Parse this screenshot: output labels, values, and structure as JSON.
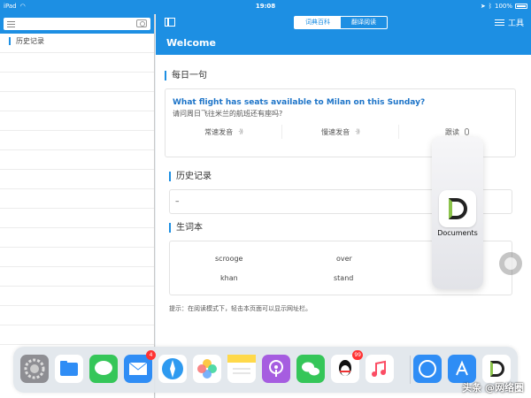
{
  "status_bar": {
    "device": "iPad",
    "time": "19:08",
    "battery": "100%"
  },
  "left_panel": {
    "title": "历史记录"
  },
  "toolbar": {
    "tabs": [
      "词典百科",
      "翻译阅读"
    ],
    "active_tab": 0,
    "tools_label": "工具"
  },
  "welcome": "Welcome",
  "daily_sentence": {
    "title": "每日一句",
    "english": "What flight has seats available to Milan on this Sunday?",
    "chinese": "请问周日飞往米兰的航班还有座吗?",
    "actions": [
      "常速发音",
      "慢速发音",
      "跟读"
    ]
  },
  "history": {
    "title": "历史记录",
    "placeholder": "–"
  },
  "vocabulary": {
    "title": "生词本",
    "words": [
      "scrooge",
      "over",
      "khan",
      "stand"
    ]
  },
  "tip": "提示：在阅读模式下，轻击本页面可以显示网址栏。",
  "slide_over": {
    "app_name": "Documents"
  },
  "dock": {
    "apps": [
      {
        "name": "settings-icon",
        "color": "#8e8e93"
      },
      {
        "name": "files-icon",
        "color": "#2f8df5"
      },
      {
        "name": "messages-icon",
        "color": "#35c659"
      },
      {
        "name": "mail-icon",
        "color": "#2f8df5",
        "badge": "4"
      },
      {
        "name": "safari-icon",
        "color": "#2e9af0"
      },
      {
        "name": "photos-icon",
        "color": "#ffffff"
      },
      {
        "name": "notes-icon",
        "color": "#ffd94a"
      },
      {
        "name": "podcasts-icon",
        "color": "#a65de0"
      },
      {
        "name": "wechat-icon",
        "color": "#35c659"
      },
      {
        "name": "qq-icon",
        "color": "#ffffff",
        "badge": "99"
      },
      {
        "name": "music-icon",
        "color": "#fb4d64"
      },
      {
        "name": "translate-app-icon",
        "color": "#2f8df5"
      },
      {
        "name": "app-store-icon",
        "color": "#2f8df5"
      },
      {
        "name": "documents-icon",
        "color": "#ffffff"
      }
    ]
  },
  "watermark": "头条 @网络圈"
}
